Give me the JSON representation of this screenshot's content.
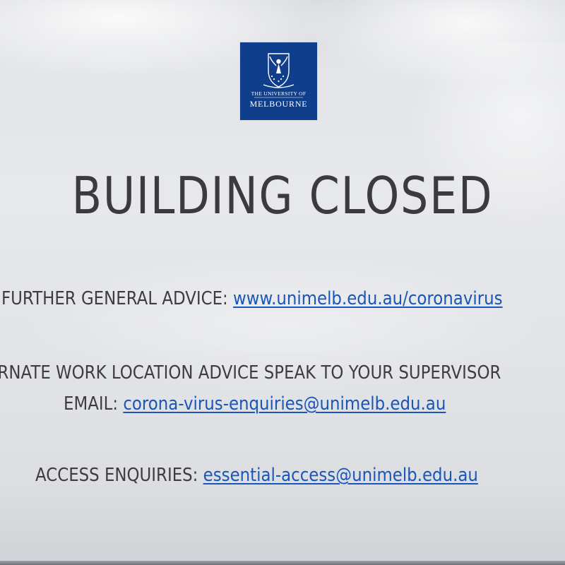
{
  "logo": {
    "line1": "THE UNIVERSITY OF",
    "line2": "MELBOURNE",
    "color": "#0f3f8c"
  },
  "sign": {
    "headline": "BUILDING CLOSED",
    "advice": {
      "label": "FURTHER GENERAL ADVICE: ",
      "link": "www.unimelb.edu.au/coronavirus"
    },
    "work_location": "ERNATE WORK LOCATION ADVICE SPEAK TO YOUR SUPERVISOR",
    "email": {
      "label": "EMAIL: ",
      "link": "corona-virus-enquiries@unimelb.edu.au"
    },
    "access": {
      "label": "ACCESS ENQUIRIES: ",
      "link": "essential-access@unimelb.edu.au"
    },
    "text_color": "#3b3a3d",
    "link_color": "#1a56b8"
  }
}
